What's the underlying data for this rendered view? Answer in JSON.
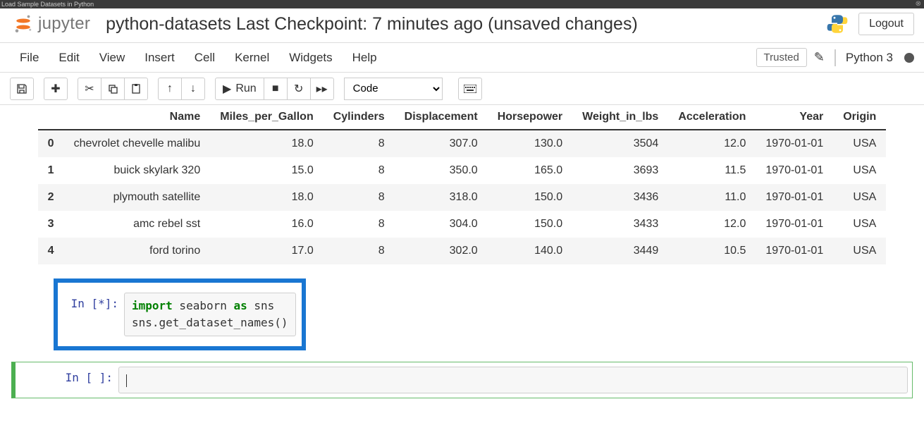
{
  "browser_tab": "Load Sample Datasets in Python",
  "logo_text": "jupyter",
  "notebook_title": "python-datasets Last Checkpoint: 7 minutes ago  (unsaved changes)",
  "logout": "Logout",
  "menu": {
    "file": "File",
    "edit": "Edit",
    "view": "View",
    "insert": "Insert",
    "cell": "Cell",
    "kernel": "Kernel",
    "widgets": "Widgets",
    "help": "Help"
  },
  "trusted": "Trusted",
  "kernel": "Python 3",
  "toolbar": {
    "run": "Run"
  },
  "celltype": "Code",
  "table": {
    "columns": [
      "",
      "Name",
      "Miles_per_Gallon",
      "Cylinders",
      "Displacement",
      "Horsepower",
      "Weight_in_lbs",
      "Acceleration",
      "Year",
      "Origin"
    ],
    "rows": [
      {
        "idx": "0",
        "cells": [
          "chevrolet chevelle malibu",
          "18.0",
          "8",
          "307.0",
          "130.0",
          "3504",
          "12.0",
          "1970-01-01",
          "USA"
        ]
      },
      {
        "idx": "1",
        "cells": [
          "buick skylark 320",
          "15.0",
          "8",
          "350.0",
          "165.0",
          "3693",
          "11.5",
          "1970-01-01",
          "USA"
        ]
      },
      {
        "idx": "2",
        "cells": [
          "plymouth satellite",
          "18.0",
          "8",
          "318.0",
          "150.0",
          "3436",
          "11.0",
          "1970-01-01",
          "USA"
        ]
      },
      {
        "idx": "3",
        "cells": [
          "amc rebel sst",
          "16.0",
          "8",
          "304.0",
          "150.0",
          "3433",
          "12.0",
          "1970-01-01",
          "USA"
        ]
      },
      {
        "idx": "4",
        "cells": [
          "ford torino",
          "17.0",
          "8",
          "302.0",
          "140.0",
          "3449",
          "10.5",
          "1970-01-01",
          "USA"
        ]
      }
    ]
  },
  "cells": {
    "exec": {
      "prompt": "In [*]:",
      "code_html": "<span class='cm-keyword'>import</span> seaborn <span class='cm-keyword'>as</span> sns\nsns.get_dataset_names()"
    },
    "empty": {
      "prompt": "In [ ]:"
    }
  }
}
